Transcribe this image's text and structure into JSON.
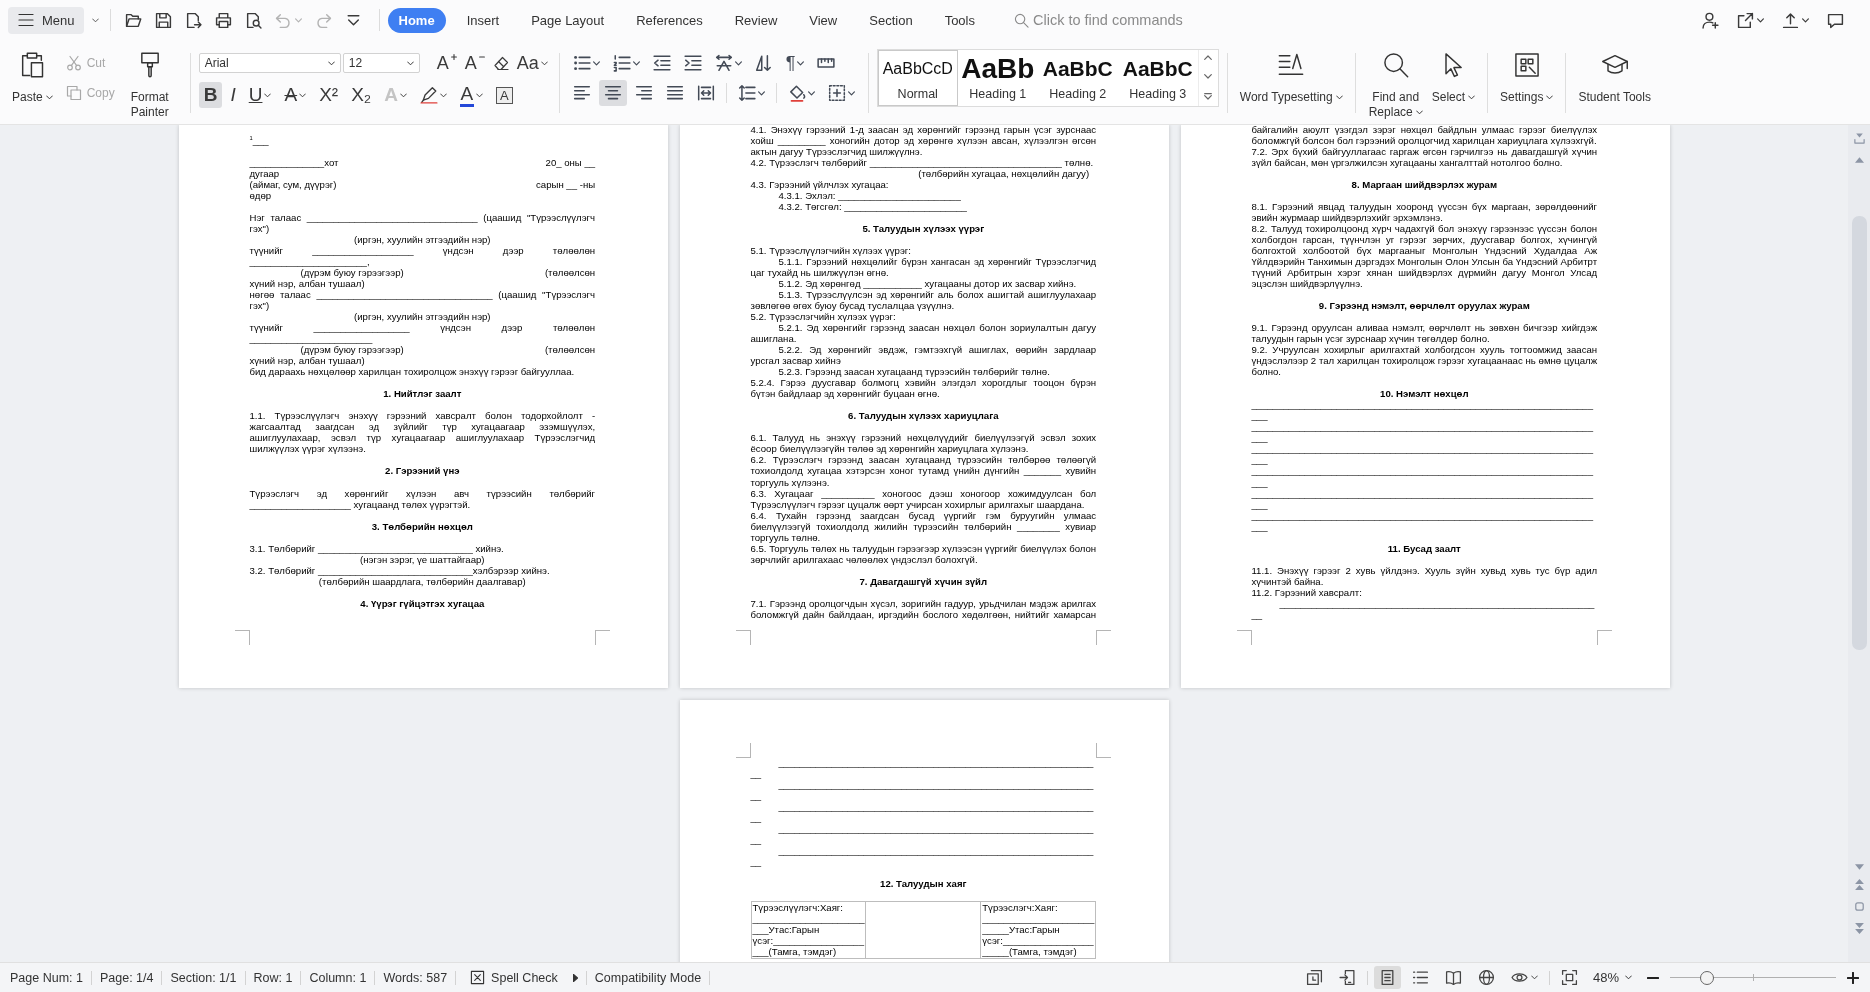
{
  "menu": {
    "label": "Menu"
  },
  "quick_access": [
    {
      "kind": "folder"
    },
    {
      "kind": "save"
    },
    {
      "kind": "export"
    },
    {
      "kind": "print"
    },
    {
      "kind": "preview"
    },
    {
      "kind": "undo",
      "disabled": true,
      "dropdown": true
    },
    {
      "kind": "redo",
      "disabled": true
    },
    {
      "kind": "customize"
    }
  ],
  "tabs": [
    {
      "label": "Home",
      "selected": true
    },
    {
      "label": "Insert",
      "selected": false
    },
    {
      "label": "Page Layout",
      "selected": false
    },
    {
      "label": "References",
      "selected": false
    },
    {
      "label": "Review",
      "selected": false
    },
    {
      "label": "View",
      "selected": false
    },
    {
      "label": "Section",
      "selected": false
    },
    {
      "label": "Tools",
      "selected": false
    }
  ],
  "search": {
    "placeholder": "Click to find commands"
  },
  "title_actions": [
    {
      "kind": "person-add"
    },
    {
      "kind": "share",
      "dropdown": true
    },
    {
      "kind": "upload",
      "dropdown": true
    },
    {
      "kind": "comment"
    }
  ],
  "ribbon": {
    "clipboard": {
      "paste": {
        "label": "Paste",
        "dropdown": true
      },
      "cut": {
        "label": "Cut",
        "disabled": true
      },
      "copy": {
        "label": "Copy",
        "disabled": true
      },
      "format_painter": {
        "label": "Format Painter"
      }
    },
    "font": {
      "name": "Arial",
      "size": "12",
      "row_1": [
        {
          "kind": "grow",
          "glyph": "A"
        },
        {
          "kind": "shrink",
          "glyph": "A"
        },
        {
          "kind": "eraser"
        },
        {
          "kind": "case",
          "glyph": "Aa",
          "dropdown": true
        }
      ],
      "row_2": [
        {
          "kind": "bold",
          "glyph": "B",
          "selected": true
        },
        {
          "kind": "italic",
          "glyph": "I",
          "selected": false
        },
        {
          "kind": "underline",
          "glyph": "U",
          "selected": false,
          "dropdown": true
        },
        {
          "kind": "strike",
          "glyph": "A",
          "selected": false,
          "dropdown": true
        },
        {
          "kind": "superscript",
          "glyph": "X²",
          "selected": false
        },
        {
          "kind": "subscript",
          "glyph": "X₂",
          "selected": false
        },
        {
          "kind": "effect",
          "glyph": "A",
          "dropdown": true
        },
        {
          "kind": "highlight",
          "dropdown": true
        },
        {
          "kind": "color",
          "glyph": "A",
          "dropdown": true
        },
        {
          "kind": "border",
          "glyph": "A"
        }
      ]
    },
    "paragraph": {
      "row_1": [
        {
          "kind": "bullets",
          "dropdown": true
        },
        {
          "kind": "numbering",
          "dropdown": true
        },
        {
          "kind": "outdent"
        },
        {
          "kind": "indent"
        },
        {
          "kind": "direction",
          "dropdown": true
        },
        {
          "kind": "sort"
        },
        {
          "kind": "marks",
          "glyph": "¶",
          "dropdown": true
        },
        {
          "kind": "ruler"
        }
      ],
      "row_2": [
        {
          "kind": "align-left",
          "selected": false
        },
        {
          "kind": "align-center",
          "selected": true
        },
        {
          "kind": "align-right",
          "selected": false
        },
        {
          "kind": "justify",
          "selected": false
        },
        {
          "kind": "distribute",
          "selected": false
        },
        {
          "kind": "line-spacing",
          "dropdown": true
        },
        {
          "kind": "shading",
          "dropdown": true
        },
        {
          "kind": "borders",
          "dropdown": true
        }
      ]
    },
    "styles": [
      {
        "kind": "normal",
        "sample": "AaBbCcD",
        "label": "Normal",
        "selected": true
      },
      {
        "kind": "heading-1",
        "sample": "AaBb",
        "label": "Heading 1",
        "selected": false
      },
      {
        "kind": "heading-2",
        "sample": "AaBbC",
        "label": "Heading 2",
        "selected": false
      },
      {
        "kind": "heading-3",
        "sample": "AaBbC",
        "label": "Heading 3",
        "selected": false
      }
    ],
    "tools": [
      {
        "kind": "typesetting",
        "label": "Word Typesetting",
        "dropdown": true
      },
      {
        "kind": "find",
        "label": "Find and Replace",
        "dropdown": true
      },
      {
        "kind": "select",
        "label": "Select",
        "dropdown": true
      },
      {
        "kind": "settings",
        "label": "Settings",
        "dropdown": true
      },
      {
        "kind": "student",
        "label": "Student Tools",
        "dropdown": false
      }
    ]
  },
  "document": {
    "pages": [
      {
        "blocks": [
          {
            "kind": "mark",
            "text": "$^{1}$___"
          },
          {
            "kind": "dateline",
            "rows": [
              {
                "left": "______________хот",
                "right": "20_ оны __",
                "rest": "дугаар"
              },
              {
                "left": "(аймаг, сум, дүүрэг)",
                "right": "сарын __ -ны",
                "rest": "өдөр"
              }
            ]
          },
          {
            "kind": "para",
            "text": "Нэг талаас ________________________________ (цаашид \"Түрээслүүлэгч гэх\")"
          },
          {
            "kind": "caption",
            "text": "(иргэн, хуулийн этгээдийн нэр)"
          },
          {
            "kind": "para",
            "text": "түүнийг ___________________ үндсэн дээр төлөөлөн ______________________,"
          },
          {
            "kind": "split-caption",
            "left": "(дүрэм буюу гэрээгээр)",
            "right": "(төлөөлсөн",
            "rest": "хүний нэр, албан тушаал)"
          },
          {
            "kind": "para",
            "text": "нөгөө талаас _________________________________ (цаашид \"Түрээслэгч гэх\")"
          },
          {
            "kind": "caption",
            "text": "(иргэн, хуулийн этгээдийн нэр)"
          },
          {
            "kind": "para",
            "text": "түүнийг __________________ үндсэн дээр төлөөлөн _______________________"
          },
          {
            "kind": "split-caption",
            "left": "(дүрэм буюу гэрээгээр)",
            "right": "(төлөөлсөн",
            "rest": "хүний нэр, албан тушаал)"
          },
          {
            "kind": "para",
            "text": "бид дараахь нөхцөлөөр харилцан тохиролцож энэхүү гэрээг байгууллаа."
          },
          {
            "kind": "heading",
            "text": "1. Нийтлэг заалт"
          },
          {
            "kind": "para",
            "text": "1.1. Түрээслүүлэгч энэхүү гэрээний хавсралт болон тодорхойлолт - жагсаалтад заагдсан эд зүйлийг түр хугацаагаар эзэмшүүлэх, ашиглуулахаар, эсвэл түр хугацаагаар ашиглуулахаар Түрээслэгчид шилжүүлэх үүрэг хүлээнэ."
          },
          {
            "kind": "heading",
            "text": "2. Гэрээний үнэ"
          },
          {
            "kind": "para",
            "text": "Түрээслэгч эд хөрөнгийг хүлээн авч түрээсийн төлбөрийг ___________________ хугацаанд төлөх үүрэгтэй."
          },
          {
            "kind": "heading",
            "text": "3. Төлбөрийн нөхцөл"
          },
          {
            "kind": "para",
            "text": "3.1. Төлбөрийг _____________________________ хийнэ."
          },
          {
            "kind": "caption",
            "text": "(нэгэн зэрэг, үе шаттайгаар)"
          },
          {
            "kind": "para",
            "text": "3.2. Төлбөрийг _____________________________хэлбэрээр хийнэ."
          },
          {
            "kind": "caption",
            "text": "(төлбөрийн шаардлага, төлбөрийн даалгавар)"
          },
          {
            "kind": "heading",
            "text": "4. Үүрэг гүйцэтгэх хугацаа"
          }
        ]
      },
      {
        "blocks": [
          {
            "kind": "para",
            "text": "4.1. Энэхүү гэрээний 1-д заасан эд хөрөнгийг гэрээнд гарын үсэг зурснаас хойш _________ хоногийн дотор эд хөрөнгө хүлээн авсан, хүлээлгэн өгсөн актын дагуу Түрээслэгчид шилжүүлнэ."
          },
          {
            "kind": "para",
            "text": "4.2. Түрээслэгч төлбөрийг ____________________________________ төлнө."
          },
          {
            "kind": "caption-right",
            "text": "(төлбөрийн хугацаа, нөхцөлийн дагуу)"
          },
          {
            "kind": "para",
            "text": "4.3. Гэрээний үйлчлэх хугацаа:"
          },
          {
            "kind": "para-indent",
            "text": "4.3.1. Эхлэл: _______________________"
          },
          {
            "kind": "para-indent",
            "text": "4.3.2. Төгсгөл: _______________________"
          },
          {
            "kind": "heading",
            "text": "5. Талуудын хүлээх үүрэг"
          },
          {
            "kind": "para",
            "text": "5.1. Түрээслүүлэгчийн хүлээх үүрэг:"
          },
          {
            "kind": "para-indent",
            "text": "5.1.1. Гэрээний нөхцөлийг бүрэн хангасан эд хөрөнгийг Түрээслэгчид цаг тухайд нь шилжүүлэн өгнө."
          },
          {
            "kind": "para-indent",
            "text": "5.1.2. Эд хөрөнгөд ___________ хугацааны дотор их засвар хийнэ."
          },
          {
            "kind": "para-indent",
            "text": "5.1.3. Түрээслүүлсэн эд хөрөнгийг аль болох ашигтай ашиглуулахаар зөвлөгөө өгөх буюу бусад туслалцаа үзүүлнэ."
          },
          {
            "kind": "para",
            "text": "5.2. Түрээслэгчийн хүлээх үүрэг:"
          },
          {
            "kind": "para-indent",
            "text": "5.2.1. Эд хөрөнгийг гэрээнд заасан нөхцөл болон зориулалтын дагуу ашиглана."
          },
          {
            "kind": "para-indent",
            "text": "5.2.2. Эд хөрөнгийг эвдэж, гэмтээхгүй ашиглах, өөрийн зардлаар урсгал засвар хийнэ"
          },
          {
            "kind": "para-indent",
            "text": "5.2.3. Гэрээнд заасан хугацаанд түрээсийн төлбөрийг төлнө."
          },
          {
            "kind": "para",
            "text": "5.2.4. Гэрээ дуусгавар болмогц хэвийн элэгдэл хорогдлыг тооцон бүрэн бүтэн байдлаар эд хөрөнгийг буцаан өгнө."
          },
          {
            "kind": "heading",
            "text": "6. Талуудын хүлээх хариуцлага"
          },
          {
            "kind": "para",
            "text": "6.1. Талууд нь энэхүү гэрээний нөхцөлүүдийг биелүүлээгүй эсвэл зохих ёсоор биелүүлээгүйн төлөө эд хөрөнгийн хариуцлага хүлээнэ."
          },
          {
            "kind": "para",
            "text": "6.2. Түрээслэгч гэрээнд заасан хугацаанд түрээсийн төлбөрөө төлөөгүй тохиолдолд хугацаа хэтэрсэн хоног тутамд үнийн дүнгийн _______ хувийн торгууль хүлээнэ."
          },
          {
            "kind": "para",
            "text": "6.3. Хугацааг __________ хоногоос дээш хоногоор хожимдуулсан бол Түрээслүүлэгч гэрээг цуцалж өөрт учирсан хохирлыг арилгахыг шаардана."
          },
          {
            "kind": "para",
            "text": "6.4. Тухайн гэрээнд заагдсан бусад үүргийг гэм буруугийн улмаас биелүүлээгүй тохиолдолд жилийн түрээсийн төлбөрийн ________ хувиар торгууль төлнө."
          },
          {
            "kind": "para",
            "text": "6.5. Торгууль төлөх нь талуудын гэрээгээр хүлээсэн үүргийг биелүүлэх болон зөрчлийг арилгахаас чөлөөлөх үндэслэл болохгүй."
          },
          {
            "kind": "heading",
            "text": "7. Давагдашгүй хүчин зүйл"
          },
          {
            "kind": "para-cont",
            "text": "7.1. Гэрээнд оролцогчдын хүсэл, зоригийн гадуур, урьдчилан мэдэж арилгах боломжгүй дайн байлдаан, иргэдийн бослого хөдөлгөөн, нийтийг хамарсан"
          }
        ]
      },
      {
        "blocks": [
          {
            "kind": "para",
            "text": "байгалийн аюулт үзэгдэл зэрэг нөхцөл байдлын улмаас гэрээг биелүүлэх боломжгүй болсон бол гэрээний оролцогчид харилцан хариуцлага хүлээхгүй."
          },
          {
            "kind": "para",
            "text": "7.2. Эрх бүхий байгууллагаас гаргаж өгсөн гэрчилгээ нь давагдашгүй хүчин зүйл байсан, мөн үргэлжилсэн хугацааны хангалттай нотолгоо болно."
          },
          {
            "kind": "heading",
            "text": "8. Маргаан шийдвэрлэх журам"
          },
          {
            "kind": "para",
            "text": "8.1. Гэрээний явцад талуудын хооронд үүссэн бүх маргаан, зөрөлдөөнийг эвийн журмаар шийдвэрлэхийг эрхэмлэнэ."
          },
          {
            "kind": "para",
            "text": "8.2. Талууд тохиролцоонд хүрч чадахгүй бол энэхүү гэрээнээс үүссэн болон холбогдон гарсан, түүнчлэн уг гэрээг зөрчих, дуусгавар болгох, хүчингүй болгохтой холбоотой бүх маргааныг Монголын Үндэсний Худалдаа Аж Үйлдвэрийн Танхимын дэргэдэх Монголын Олон Улсын ба Үндэсний Арбитрт түүний Арбитрын хэрэг хянан шийдвэрлэх дүрмийн дагуу Монгол Улсад эцэслэн шийдвэрлүүлнэ."
          },
          {
            "kind": "heading",
            "text": "9. Гэрээнд нэмэлт, өөрчлөлт оруулах журам"
          },
          {
            "kind": "para",
            "text": "9.1. Гэрээнд оруулсан аливаа нэмэлт, өөрчлөлт нь зөвхөн бичгээр хийгдэж талуудын гарын үсэг зурснаар хүчин төгөлдөр болно."
          },
          {
            "kind": "para",
            "text": "9.2. Учруулсан хохирлыг арилгахтай холбогдсон хууль тогтоомжид заасан үндэслэлээр 2 тал харилцан тохиролцож гэрээг хугацаанаас нь өмнө цуцалж болно."
          },
          {
            "kind": "heading-tight",
            "text": "10. Нэмэлт нөхцөл"
          },
          {
            "kind": "blank",
            "text": "___________________________________________________________________"
          },
          {
            "kind": "blank",
            "text": "___________________________________________________________________"
          },
          {
            "kind": "blank",
            "text": "___________________________________________________________________"
          },
          {
            "kind": "blank",
            "text": "___________________________________________________________________"
          },
          {
            "kind": "blank",
            "text": "___________________________________________________________________"
          },
          {
            "kind": "blank",
            "text": "___________________________________________________________________"
          },
          {
            "kind": "heading",
            "text": "11. Бусад заалт"
          },
          {
            "kind": "para",
            "text": "11.1. Энэхүү гэрээг 2 хувь үйлдэнэ. Хууль зүйн хувьд хувь тус бүр адил хүчинтэй байна."
          },
          {
            "kind": "para",
            "text": "11.2. Гэрээний хавсралт:"
          },
          {
            "kind": "blank-indent",
            "text": "_____________________________________________________________"
          }
        ]
      },
      {
        "blocks": [
          {
            "kind": "blank-indent",
            "text": "_____________________________________________________________"
          },
          {
            "kind": "blank-indent",
            "text": "_____________________________________________________________"
          },
          {
            "kind": "blank-indent",
            "text": "_____________________________________________________________"
          },
          {
            "kind": "blank-indent",
            "text": "_____________________________________________________________"
          },
          {
            "kind": "blank-indent",
            "text": "_____________________________________________________________"
          },
          {
            "kind": "heading",
            "text": "12. Талуудын хаяг"
          },
          {
            "kind": "table",
            "cells": [
              {
                "lines": [
                  "Түрээслүүлэгч:Хаяг:",
                  "_____________________",
                  "___Утас:Гарын",
                  "үсэг:_________________",
                  "___(Тамга, тэмдэг)"
                ]
              },
              {},
              {
                "lines": [
                  "Түрээслэгч:Хаяг:",
                  "_____________________",
                  "_____Утас:Гарын",
                  "үсэг:_________________",
                  "_____(Тамга, тэмдэг)"
                ]
              }
            ]
          }
        ]
      }
    ]
  },
  "scrollbar": {
    "top": [
      {
        "kind": "collapse"
      },
      {
        "kind": "up"
      }
    ],
    "bottom": [
      {
        "kind": "down"
      },
      {
        "kind": "prev-page"
      },
      {
        "kind": "browse"
      },
      {
        "kind": "next-page"
      }
    ]
  },
  "status_bar": {
    "items": [
      {
        "label": "Page Num: 1"
      },
      {
        "label": "Page: 1/4"
      },
      {
        "label": "Section: 1/1"
      },
      {
        "label": "Row: 1"
      },
      {
        "label": "Column: 1"
      },
      {
        "label": "Words: 587"
      }
    ],
    "spell_check": {
      "label": "Spell Check"
    },
    "mode": "Compatibility Mode",
    "tools": [
      {
        "kind": "page-note"
      },
      {
        "kind": "device"
      }
    ],
    "views": [
      {
        "kind": "page",
        "selected": true
      },
      {
        "kind": "outline",
        "selected": false
      },
      {
        "kind": "reading",
        "selected": false
      },
      {
        "kind": "web",
        "selected": false
      }
    ],
    "eye": {
      "dropdown": true
    },
    "zoom": {
      "label": "48%",
      "level": 0.22
    }
  }
}
